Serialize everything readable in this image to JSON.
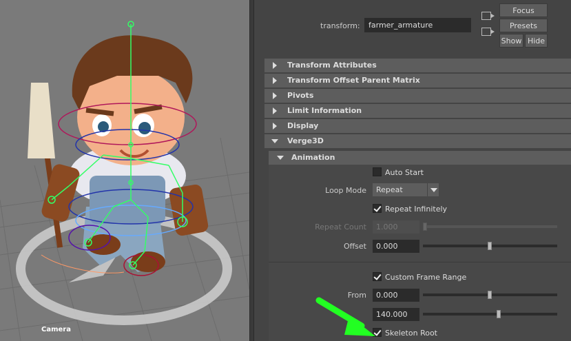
{
  "viewport": {
    "camera_label": "Camera"
  },
  "attribute_editor": {
    "transform_label": "transform:",
    "transform_value": "farmer_armature",
    "buttons": {
      "focus": "Focus",
      "presets": "Presets",
      "show": "Show",
      "hide": "Hide"
    },
    "sections": [
      {
        "label": "Transform Attributes",
        "expanded": false
      },
      {
        "label": "Transform Offset Parent Matrix",
        "expanded": false
      },
      {
        "label": "Pivots",
        "expanded": false
      },
      {
        "label": "Limit Information",
        "expanded": false
      },
      {
        "label": "Display",
        "expanded": false
      },
      {
        "label": "Verge3D",
        "expanded": true
      }
    ],
    "animation": {
      "header": "Animation",
      "auto_start": {
        "label": "Auto Start",
        "checked": false
      },
      "loop_mode": {
        "label": "Loop Mode",
        "value": "Repeat"
      },
      "repeat_infinitely": {
        "label": "Repeat Infinitely",
        "checked": true
      },
      "repeat_count": {
        "label": "Repeat Count",
        "value": "1.000",
        "enabled": false,
        "slider_fraction": 0.0
      },
      "offset": {
        "label": "Offset",
        "value": "0.000",
        "slider_fraction": 0.5
      },
      "custom_frame_range": {
        "label": "Custom Frame Range",
        "checked": true
      },
      "from": {
        "label": "From",
        "value": "0.000",
        "slider_fraction": 0.5
      },
      "to": {
        "value": "140.000",
        "slider_fraction": 0.57
      },
      "skeleton_root": {
        "label": "Skeleton Root",
        "checked": true
      }
    }
  },
  "colors": {
    "panel_bg": "#444444",
    "section_bg": "#5d5d5d",
    "field_bg": "#2b2b2b",
    "viewport_bg": "#7a7a7a",
    "skeleton_green": "#33ff66",
    "annotation_arrow": "#22ff22"
  },
  "icons": [
    "upstream-node-icon",
    "downstream-node-icon",
    "expand-triangle-icon",
    "collapse-triangle-icon",
    "checkbox-check-icon",
    "dropdown-arrow-icon"
  ]
}
